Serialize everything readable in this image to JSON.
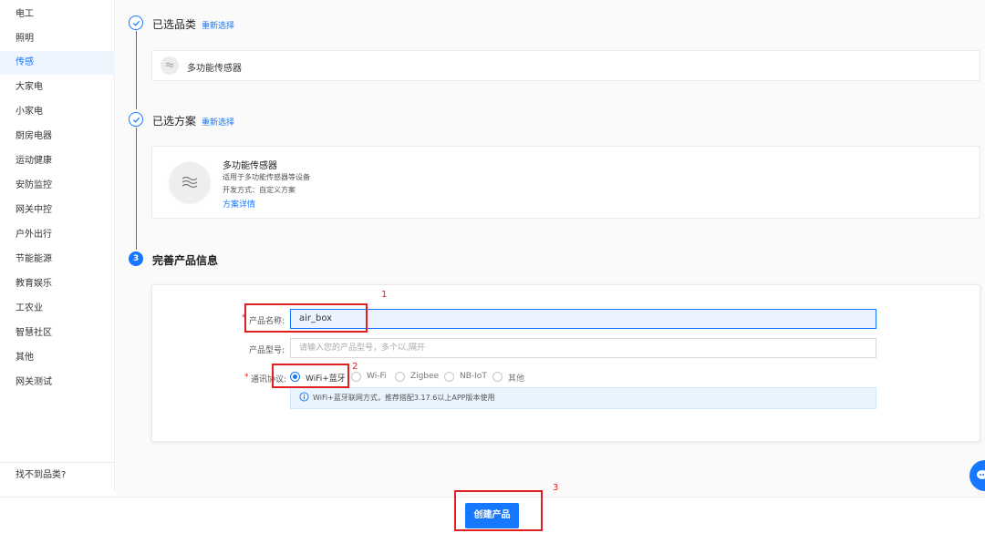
{
  "sidebar": {
    "categories": [
      "电工",
      "照明",
      "传感",
      "大家电",
      "小家电",
      "厨房电器",
      "运动健康",
      "安防监控",
      "网关中控",
      "户外出行",
      "节能能源",
      "教育娱乐",
      "工农业",
      "智慧社区",
      "其他",
      "网关测试"
    ],
    "active_index": 2,
    "footer": "找不到品类?"
  },
  "steps": {
    "step1": {
      "title": "已选品类",
      "relink": "重新选择",
      "item": "多功能传感器"
    },
    "step2": {
      "title": "已选方案",
      "relink": "重新选择",
      "name": "多功能传感器",
      "desc": "适用于多功能传感器等设备",
      "dev": "开发方式：自定义方案",
      "link": "方案详情"
    },
    "step3": {
      "number": "3",
      "title": "完善产品信息"
    }
  },
  "form": {
    "name_label": "产品名称:",
    "name_value": "air_box",
    "model_label": "产品型号:",
    "model_placeholder": "请输入您的产品型号，多个以,隔开",
    "protocol_label": "通讯协议:",
    "protocols": [
      "WiFi+蓝牙",
      "Wi-Fi",
      "Zigbee",
      "NB-IoT",
      "其他"
    ],
    "protocol_selected": 0,
    "tip": "WiFi+蓝牙联网方式，推荐搭配3.17.6以上APP版本使用"
  },
  "annotations": [
    "1",
    "2",
    "3"
  ],
  "actions": {
    "create": "创建产品"
  },
  "colors": {
    "accent": "#1677ff",
    "annotation": "#e02020"
  }
}
